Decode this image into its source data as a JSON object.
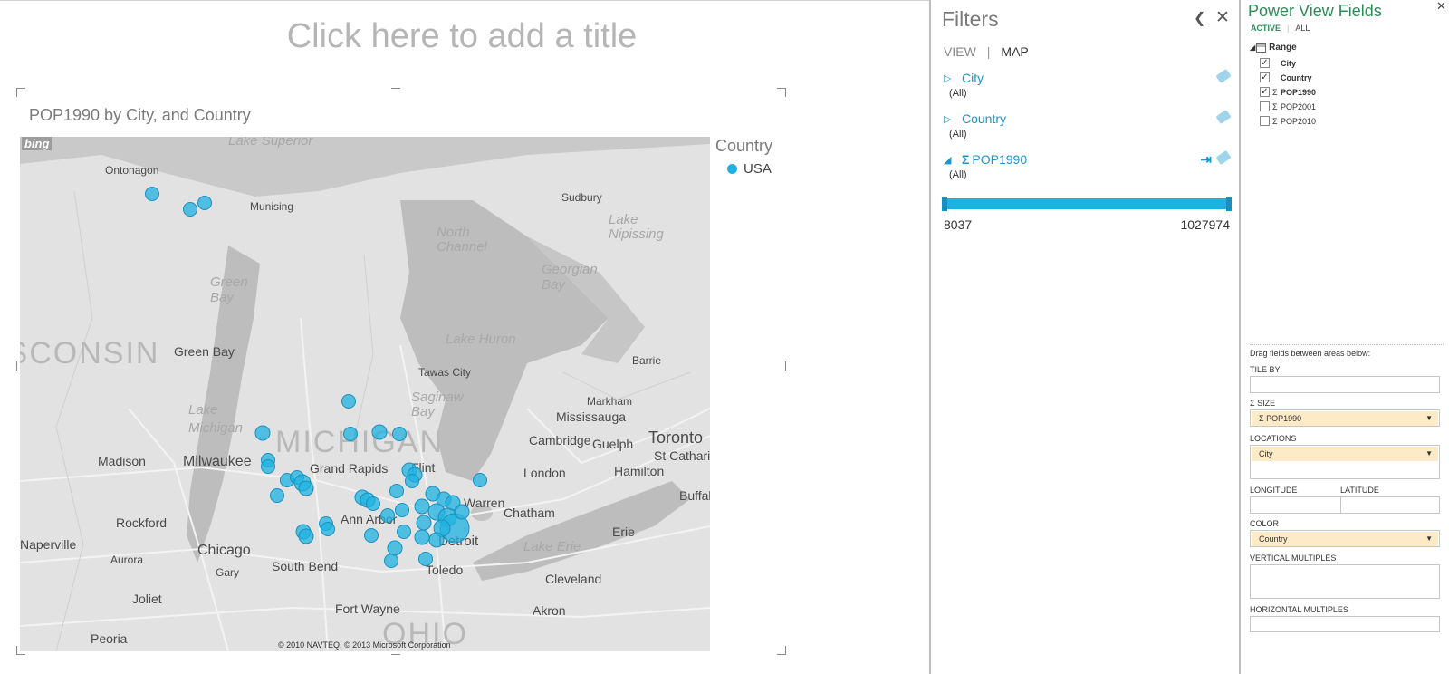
{
  "canvas": {
    "title_placeholder": "Click here to add a title",
    "viz_title": "POP1990 by City, and Country",
    "map": {
      "provider_logo": "bing",
      "copyright": "© 2010 NAVTEQ, © 2013 Microsoft Corporation",
      "labels": [
        {
          "text": "Lake Superior",
          "kind": "water"
        },
        {
          "text": "Ontonagon"
        },
        {
          "text": "Munising"
        },
        {
          "text": "Sudbury"
        },
        {
          "text": "North Channel",
          "kind": "water"
        },
        {
          "text": "Lake Nipissing",
          "kind": "water"
        },
        {
          "text": "Georgian Bay",
          "kind": "water"
        },
        {
          "text": "Green Bay",
          "kind": "water"
        },
        {
          "text": "Lake Huron",
          "kind": "water"
        },
        {
          "text": "Green Bay"
        },
        {
          "text": "Tawas City"
        },
        {
          "text": "Barrie"
        },
        {
          "text": "Saginaw Bay",
          "kind": "water"
        },
        {
          "text": "Lake Michigan",
          "kind": "water"
        },
        {
          "text": "Markham"
        },
        {
          "text": "Mississauga"
        },
        {
          "text": "Cambridge"
        },
        {
          "text": "Guelph"
        },
        {
          "text": "Toronto"
        },
        {
          "text": "St Catharines"
        },
        {
          "text": "Madison"
        },
        {
          "text": "Milwaukee"
        },
        {
          "text": "Grand Rapids"
        },
        {
          "text": "Flint"
        },
        {
          "text": "London"
        },
        {
          "text": "Hamilton"
        },
        {
          "text": "Warren"
        },
        {
          "text": "Chatham"
        },
        {
          "text": "Rockford"
        },
        {
          "text": "Ann Arbor"
        },
        {
          "text": "Detroit"
        },
        {
          "text": "Erie"
        },
        {
          "text": "Buffalo"
        },
        {
          "text": "Lake Erie",
          "kind": "water"
        },
        {
          "text": "Chicago"
        },
        {
          "text": "Naperville"
        },
        {
          "text": "Aurora"
        },
        {
          "text": "Gary"
        },
        {
          "text": "South Bend"
        },
        {
          "text": "Toledo"
        },
        {
          "text": "Cleveland"
        },
        {
          "text": "Joliet"
        },
        {
          "text": "Fort Wayne"
        },
        {
          "text": "Akron"
        },
        {
          "text": "Peoria"
        },
        {
          "text": "MICHIGAN",
          "kind": "big"
        },
        {
          "text": "WISCONSIN",
          "kind": "big"
        },
        {
          "text": "OHIO",
          "kind": "big"
        }
      ]
    },
    "legend": {
      "title": "Country",
      "items": [
        {
          "label": "USA",
          "color": "#1fb2e0"
        }
      ]
    }
  },
  "filters_pane": {
    "title": "Filters",
    "collapse_icon": "chevron-left-icon",
    "close_icon": "close-icon",
    "tabs": [
      {
        "label": "VIEW",
        "active": false
      },
      {
        "label": "MAP",
        "active": true
      }
    ],
    "items": [
      {
        "field": "City",
        "value": "(All)",
        "expanded": false,
        "numeric": false
      },
      {
        "field": "Country",
        "value": "(All)",
        "expanded": false,
        "numeric": false
      },
      {
        "field": "POP1990",
        "value": "(All)",
        "expanded": true,
        "numeric": true
      }
    ],
    "range": {
      "min_label": "8037",
      "max_label": "1027974",
      "selected_fraction": [
        0,
        1
      ],
      "color": "#1fb2e0"
    }
  },
  "field_list": {
    "title": "Power View Fields",
    "tabs": [
      {
        "label": "ACTIVE",
        "active": true
      },
      {
        "label": "ALL",
        "active": false
      }
    ],
    "table": {
      "name": "Range",
      "fields": [
        {
          "name": "City",
          "checked": true,
          "sigma": false
        },
        {
          "name": "Country",
          "checked": true,
          "sigma": false
        },
        {
          "name": "POP1990",
          "checked": true,
          "sigma": true
        },
        {
          "name": "POP2001",
          "checked": false,
          "sigma": true
        },
        {
          "name": "POP2010",
          "checked": false,
          "sigma": true
        }
      ]
    },
    "drag_hint": "Drag fields between areas below:",
    "areas": {
      "tile_by": {
        "label": "TILE BY",
        "value": ""
      },
      "size": {
        "label": "SIZE",
        "value": "POP1990"
      },
      "locations": {
        "label": "LOCATIONS",
        "value": "City"
      },
      "longitude": {
        "label": "LONGITUDE",
        "value": ""
      },
      "latitude": {
        "label": "LATITUDE",
        "value": ""
      },
      "color": {
        "label": "COLOR",
        "value": "Country"
      },
      "vertical_multiples": {
        "label": "VERTICAL MULTIPLES",
        "value": ""
      },
      "horizontal_multiples": {
        "label": "HORIZONTAL MULTIPLES",
        "value": ""
      }
    }
  }
}
